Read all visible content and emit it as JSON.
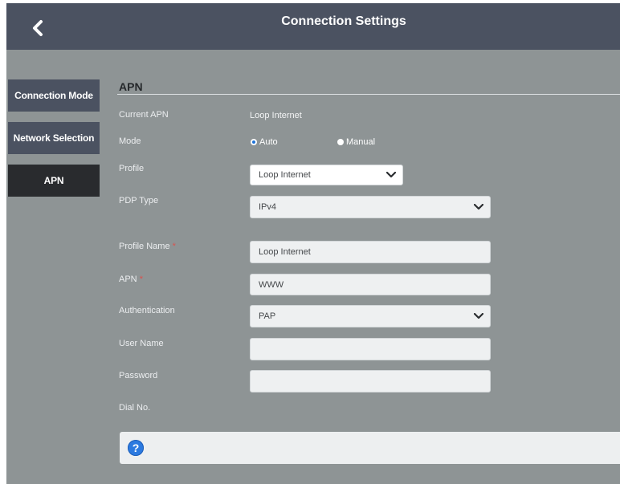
{
  "header": {
    "title": "Connection Settings",
    "back_icon": "chevron-left-icon"
  },
  "sidebar": {
    "items": [
      {
        "label": "Connection Mode",
        "active": false
      },
      {
        "label": "Network Selection",
        "active": false
      },
      {
        "label": "APN",
        "active": true
      }
    ]
  },
  "apn": {
    "section_title": "APN",
    "current_apn": {
      "label": "Current APN",
      "value": "Loop Internet"
    },
    "mode": {
      "label": "Mode",
      "options": [
        "Auto",
        "Manual"
      ],
      "selected": "Auto"
    },
    "profile": {
      "label": "Profile",
      "value": "Loop Internet"
    },
    "pdp_type": {
      "label": "PDP Type",
      "value": "IPv4"
    },
    "profile_name": {
      "label": "Profile Name",
      "required_mark": "*",
      "value": "Loop Internet"
    },
    "apn_field": {
      "label": "APN",
      "required_mark": "*",
      "value": "WWW"
    },
    "authentication": {
      "label": "Authentication",
      "value": "PAP"
    },
    "user_name": {
      "label": "User Name",
      "value": ""
    },
    "password": {
      "label": "Password",
      "value": ""
    },
    "dial_no": {
      "label": "Dial No."
    }
  },
  "help": {
    "icon": "help-icon",
    "glyph": "?"
  },
  "colors": {
    "header_bg": "#4b5261",
    "body_bg": "#8e9495",
    "active_tab": "#292b2e",
    "radio_accent": "#1e73d8",
    "required": "#d9534f"
  }
}
